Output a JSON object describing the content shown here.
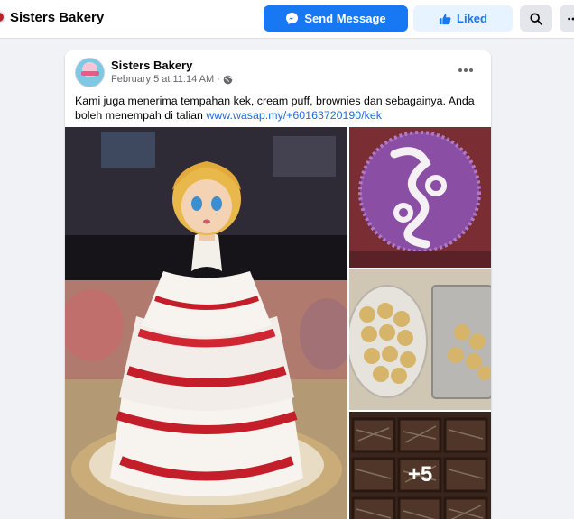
{
  "header": {
    "page_name": "Sisters Bakery",
    "send_message_label": "Send Message",
    "liked_label": "Liked"
  },
  "post": {
    "author": "Sisters Bakery",
    "timestamp": "February 5 at 11:14 AM",
    "separator": "·",
    "text": "Kami juga menerima tempahan kek, cream puff, brownies dan sebagainya. Anda boleh menempah di talian ",
    "link": "www.wasap.my/+60163720190/kek",
    "more_photos_count": "+5"
  },
  "colors": {
    "accent": "#1877f2",
    "liked_bg": "#e7f3ff",
    "link": "#216fdb"
  },
  "icons": {
    "send_message": "messenger-icon",
    "liked": "thumbs-up-icon",
    "search": "search-icon",
    "more": "more-icon",
    "privacy": "globe-icon",
    "post_menu": "ellipsis-icon"
  }
}
